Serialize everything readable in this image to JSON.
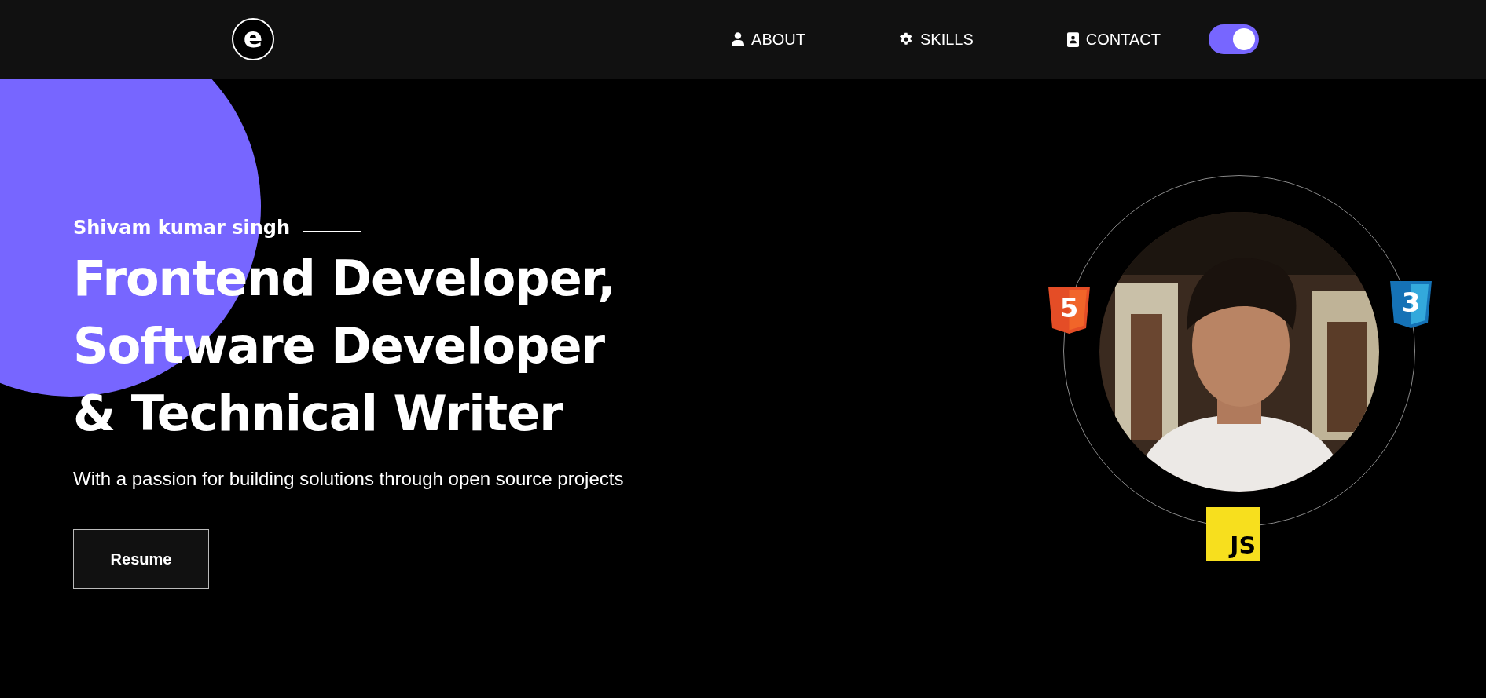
{
  "header": {
    "logo": "e",
    "nav": [
      {
        "label": "ABOUT"
      },
      {
        "label": "SKILLS"
      },
      {
        "label": "CONTACT"
      }
    ],
    "theme_toggle": {
      "on": true
    }
  },
  "hero": {
    "name": "Shivam kumar singh",
    "headline": [
      "Frontend Developer,",
      "Software Developer",
      "& Technical Writer"
    ],
    "tagline": "With a passion for building solutions through open source projects",
    "button": "Resume",
    "badges": [
      {
        "kind": "html",
        "text": "5"
      },
      {
        "kind": "css",
        "text": "3"
      },
      {
        "kind": "js",
        "text": "JS"
      }
    ]
  }
}
